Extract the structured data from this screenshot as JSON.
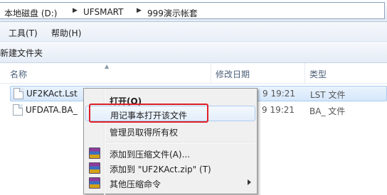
{
  "address_bar": {
    "crumbs": [
      "本地磁盘 (D:)",
      "UFSMART",
      "999演示帐套"
    ],
    "separator": "▶"
  },
  "menubar": {
    "items": [
      "工具(T)",
      "帮助(H)"
    ]
  },
  "toolbar": {
    "new_folder": "新建文件夹"
  },
  "columns": {
    "name": "名称",
    "modified": "修改日期",
    "type": "类型"
  },
  "files": [
    {
      "name": "UF2KAct.Lst",
      "modified": "9 19:21",
      "type": "LST 文件",
      "selected": true
    },
    {
      "name": "UFDATA.BA_",
      "modified": "9 19:21",
      "type": "BA_ 文件",
      "selected": false
    }
  ],
  "context_menu": {
    "items": [
      {
        "label": "打开(O)",
        "bold": true
      },
      {
        "label": "用记事本打开该文件",
        "highlighted": true
      },
      {
        "label": "管理员取得所有权"
      },
      {
        "label": "添加到压缩文件(A)...",
        "icon": "winrar-icon"
      },
      {
        "label": "添加到 \"UF2KAct.zip\" (T)",
        "icon": "winrar-icon"
      },
      {
        "label": "其他压缩命令",
        "icon": "winrar-icon",
        "submenu": true
      }
    ]
  },
  "colors": {
    "highlight_border": "#e01f26",
    "selection": "#d5e7fb"
  }
}
